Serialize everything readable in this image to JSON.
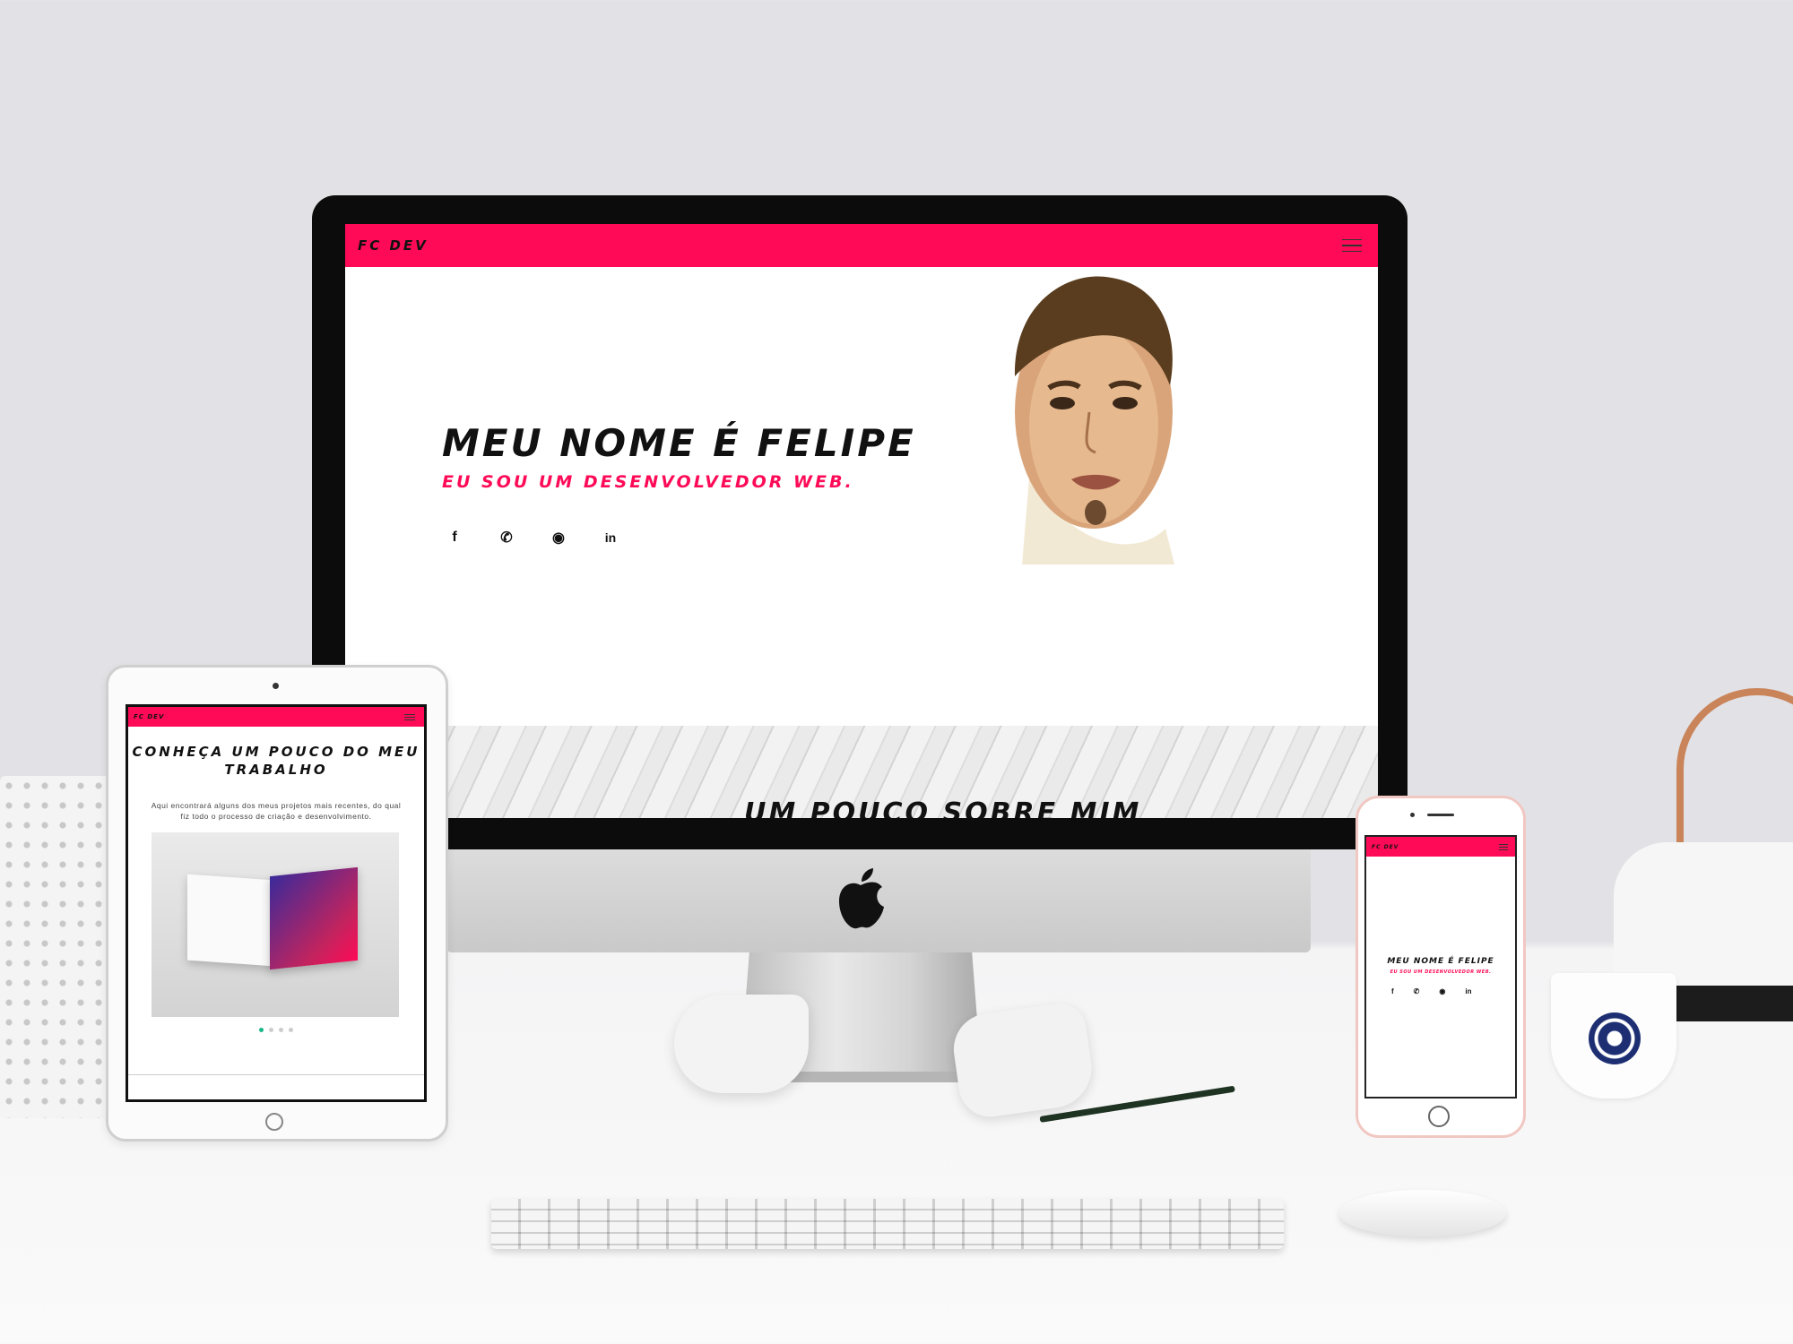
{
  "site": {
    "brand": "FC DEV",
    "brand_color": "#ff0a57"
  },
  "desktop": {
    "hero": {
      "title": "MEU NOME É FELIPE",
      "subtitle": "EU SOU UM DESENVOLVEDOR WEB."
    },
    "social_icons": [
      {
        "name": "facebook-icon",
        "glyph": "f"
      },
      {
        "name": "whatsapp-icon",
        "glyph": "✆"
      },
      {
        "name": "github-icon",
        "glyph": "◉"
      },
      {
        "name": "linkedin-icon",
        "glyph": "in"
      }
    ],
    "about_title": "UM POUCO SOBRE MIM"
  },
  "tablet": {
    "heading_line1": "CONHEÇA UM POUCO DO MEU",
    "heading_line2": "TRABALHO",
    "text": "Aqui encontrará alguns dos meus projetos mais recentes, do qual fiz todo o processo de criação e desenvolvimento.",
    "carousel_dots": 4,
    "carousel_active": 1
  },
  "phone": {
    "hero_title": "MEU NOME É FELIPE",
    "hero_subtitle": "EU SOU UM DESENVOLVEDOR WEB."
  }
}
